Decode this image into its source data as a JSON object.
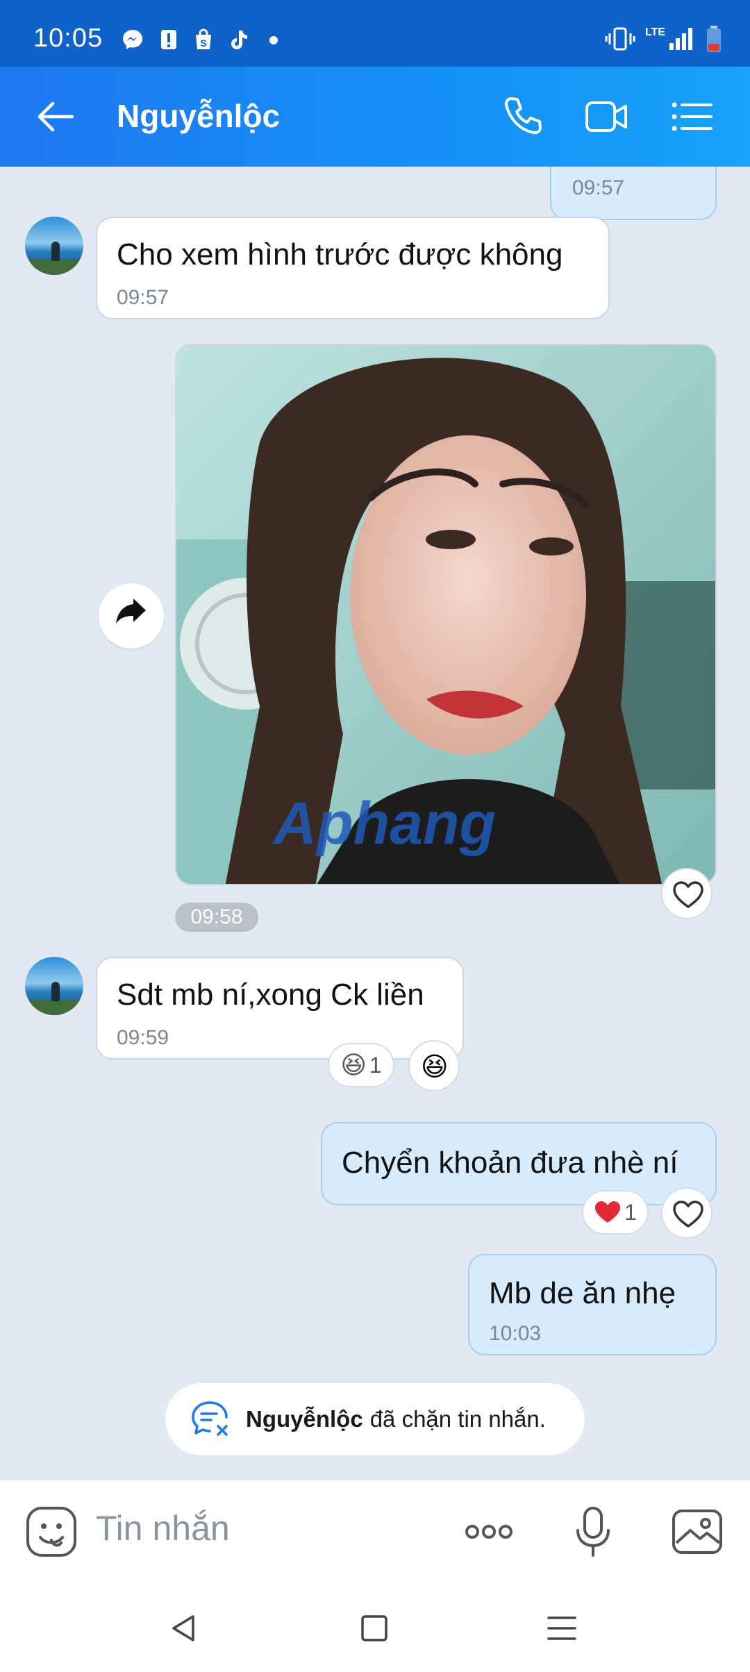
{
  "status_bar": {
    "time": "10:05",
    "network": "LTE"
  },
  "header": {
    "back_label": "Back",
    "contact_name": "Nguyễnlộc"
  },
  "messages": [
    {
      "time": "09:57"
    },
    {
      "sender": "contact",
      "text": "Cho xem hình trước được không",
      "time": "09:57"
    },
    {
      "sender": "me",
      "type": "image",
      "watermark": "Aphang",
      "time": "09:58"
    },
    {
      "sender": "contact",
      "text": "Sdt mb ní,xong Ck liền",
      "time": "09:59",
      "reaction_count": "1"
    },
    {
      "sender": "me",
      "text": "Chyển khoản đưa nhè ní",
      "reaction_count": "1"
    },
    {
      "sender": "me",
      "text": "Mb de ăn nhẹ",
      "time": "10:03"
    }
  ],
  "blocked_notice": {
    "name": "Nguyễnlộc",
    "message": "đã chặn tin nhắn."
  },
  "input": {
    "placeholder": "Tin nhắn"
  },
  "colors": {
    "header": "#1a85f4",
    "status_bar": "#0f62c9",
    "chat_bg": "#e2e9f2",
    "my_bubble": "#d6ecfd"
  }
}
